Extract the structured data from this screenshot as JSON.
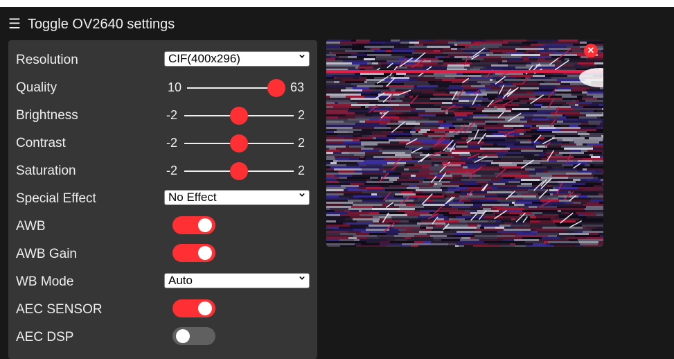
{
  "header": {
    "menu_icon": "hamburger-icon",
    "title": "Toggle OV2640 settings"
  },
  "settings": {
    "resolution": {
      "label": "Resolution",
      "value": "CIF(400x296)"
    },
    "quality": {
      "label": "Quality",
      "min": "10",
      "max": "63",
      "value": 63
    },
    "brightness": {
      "label": "Brightness",
      "min": "-2",
      "max": "2",
      "value": 0
    },
    "contrast": {
      "label": "Contrast",
      "min": "-2",
      "max": "2",
      "value": 0
    },
    "saturation": {
      "label": "Saturation",
      "min": "-2",
      "max": "2",
      "value": 0
    },
    "special_effect": {
      "label": "Special Effect",
      "value": "No Effect"
    },
    "awb": {
      "label": "AWB",
      "on": true
    },
    "awb_gain": {
      "label": "AWB Gain",
      "on": true
    },
    "wb_mode": {
      "label": "WB Mode",
      "value": "Auto"
    },
    "aec_sensor": {
      "label": "AEC SENSOR",
      "on": true
    },
    "aec_dsp": {
      "label": "AEC DSP",
      "on": false
    }
  },
  "stream": {
    "close_icon": "close-icon",
    "close_glyph": "✕"
  },
  "colors": {
    "accent": "#ff3034",
    "panel": "#363636",
    "background": "#181818",
    "toggle_off": "#606060"
  }
}
